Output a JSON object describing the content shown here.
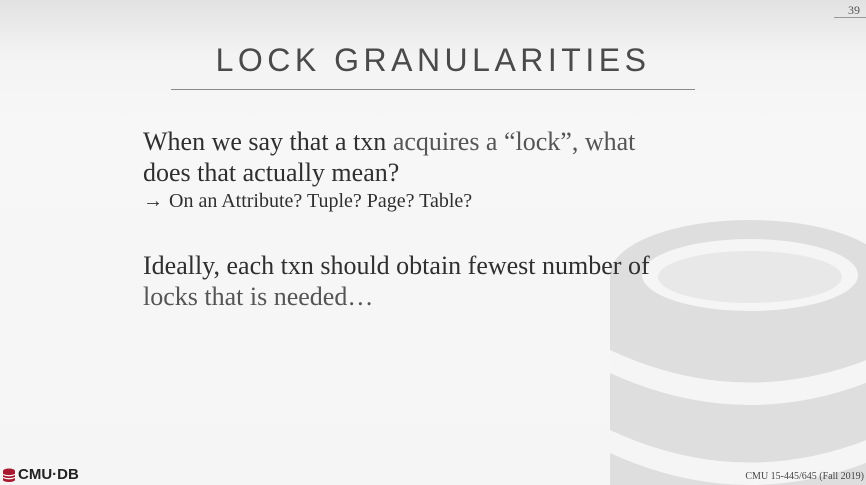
{
  "slide": {
    "page_number": "39",
    "title": "LOCK GRANULARITIES",
    "bullet1_part1": "When we say that a txn ",
    "bullet1_part2": "acquires a “lock”, what",
    "bullet1_line2": "does that actually mean?",
    "sub_arrow": "→",
    "sub_text": "On an Attribute? Tuple? Page? Table?",
    "bullet2_line1": "Ideally, each txn should obtain fewest number of",
    "bullet2_line2": "locks that is needed…"
  },
  "footer": {
    "logo_text": "CMU·DB",
    "course_text": "CMU 15-445/645 (Fall 2019)"
  },
  "colors": {
    "logo_red": "#a6192e",
    "watermark": "#dcdcdc"
  }
}
